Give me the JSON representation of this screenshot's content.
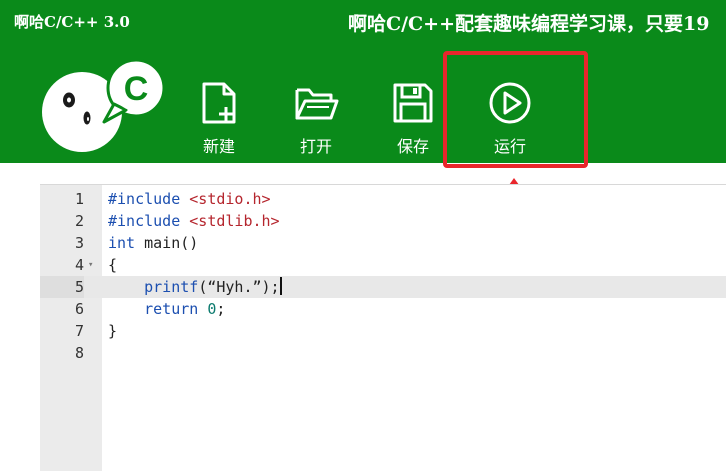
{
  "app": {
    "title": "啊哈C/C++ 3.0",
    "promo": "啊哈C/C++配套趣味编程学习课，只要19"
  },
  "logo": {
    "letter": "C"
  },
  "toolbar": {
    "new_label": "新建",
    "open_label": "打开",
    "save_label": "保存",
    "run_label": "运行"
  },
  "editor": {
    "active_line": 5,
    "lines": [
      {
        "num": "1",
        "parts": [
          [
            "kw",
            "#include "
          ],
          [
            "str",
            "<stdio.h>"
          ]
        ]
      },
      {
        "num": "2",
        "parts": [
          [
            "kw",
            "#include "
          ],
          [
            "str",
            "<stdlib.h>"
          ]
        ]
      },
      {
        "num": "3",
        "parts": [
          [
            "kw",
            "int"
          ],
          [
            "",
            " main()"
          ]
        ]
      },
      {
        "num": "4",
        "fold": "▾",
        "parts": [
          [
            "",
            "{"
          ]
        ]
      },
      {
        "num": "5",
        "parts": [
          [
            "",
            "    "
          ],
          [
            "kw",
            "printf"
          ],
          [
            "",
            "(“Hyh.”);"
          ]
        ]
      },
      {
        "num": "6",
        "parts": [
          [
            "",
            "    "
          ],
          [
            "kw",
            "return "
          ],
          [
            "numlit",
            "0"
          ],
          [
            "",
            ";"
          ]
        ]
      },
      {
        "num": "7",
        "parts": [
          [
            "",
            "}"
          ]
        ]
      },
      {
        "num": "8",
        "parts": []
      }
    ]
  },
  "colors": {
    "header_bg": "#0a8a1a",
    "highlight": "#e9262c",
    "keyword": "#1c4fb0",
    "string": "#b5262e"
  }
}
